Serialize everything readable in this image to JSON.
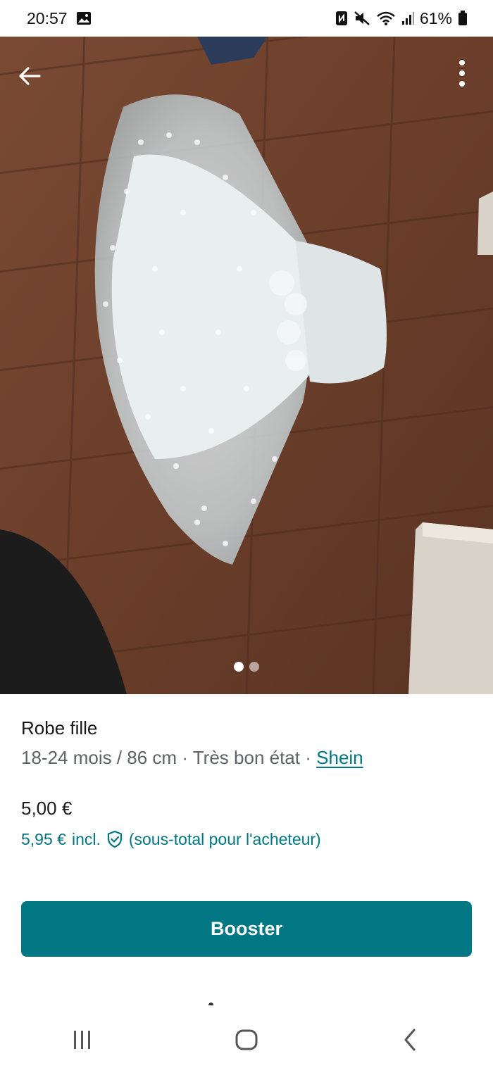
{
  "status_bar": {
    "time": "20:57",
    "battery": "61%",
    "icons": [
      "gallery-icon",
      "nfc-icon",
      "mute-icon",
      "wifi-icon",
      "signal-icon",
      "battery-icon"
    ]
  },
  "photo": {
    "icons": [
      "back-arrow-icon",
      "more-vertical-icon"
    ],
    "pagination": {
      "current": 1,
      "total": 2
    }
  },
  "item": {
    "title": "Robe fille",
    "size": "18-24 mois / 86 cm",
    "separator": "·",
    "condition": "Très bon état",
    "brand": "Shein",
    "price": "5,00 €",
    "price_incl_amount": "5,95 €",
    "price_incl_label": "incl.",
    "price_incl_note": "(sous-total pour l'acheteur)"
  },
  "actions": {
    "boost_label": "Booster"
  },
  "nav": {
    "icons": [
      "recents-icon",
      "home-icon",
      "back-icon"
    ]
  },
  "colors": {
    "accent": "#007782",
    "text": "#1a1a1a",
    "muted": "#5f6368"
  }
}
